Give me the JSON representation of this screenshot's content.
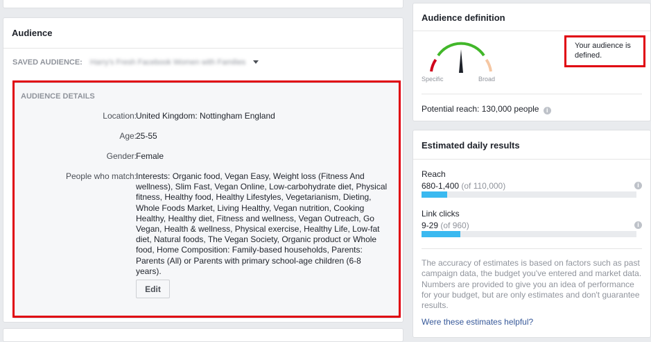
{
  "audience_card": {
    "title": "Audience",
    "saved_label": "SAVED AUDIENCE:",
    "saved_value": "Harry's Fresh Facebook Women with Families",
    "details": {
      "heading": "AUDIENCE DETAILS",
      "location_label": "Location:",
      "location_value": "United Kingdom: Nottingham England",
      "age_label": "Age:",
      "age_value": "25-55",
      "gender_label": "Gender:",
      "gender_value": "Female",
      "match_label": "People who match:",
      "match_value": "Interests: Organic food, Vegan Easy, Weight loss (Fitness And wellness), Slim Fast, Vegan Online, Low-carbohydrate diet, Physical fitness, Healthy food, Healthy Lifestyles, Vegetarianism, Dieting, Whole Foods Market, Living Healthy, Vegan nutrition, Cooking Healthy, Healthy diet, Fitness and wellness, Vegan Outreach, Go Vegan, Health & wellness, Physical exercise, Healthy Life, Low-fat diet, Natural foods, The Vegan Society, Organic product or Whole food, Home Composition: Family-based households, Parents: Parents (All) or Parents with primary school-age children (6-8 years).",
      "edit_label": "Edit"
    }
  },
  "definition_card": {
    "title": "Audience definition",
    "gauge_left": "Specific",
    "gauge_right": "Broad",
    "status_text": "Your audience is defined.",
    "reach_label": "Potential reach: 130,000 people",
    "gauge_colors": {
      "left": "#d0021b",
      "middle": "#42b72a",
      "right": "#f5c7a3",
      "needle": "#1d2129"
    }
  },
  "estimates_card": {
    "title": "Estimated daily results",
    "reach": {
      "label": "Reach",
      "range": "680-1,400",
      "total": "(of 110,000)",
      "fill_fraction": 0.12
    },
    "clicks": {
      "label": "Link clicks",
      "range": "9-29",
      "total": "(of 960)",
      "fill_fraction": 0.18
    },
    "disclaimer": "The accuracy of estimates is based on factors such as past campaign data, the budget you've entered and market data. Numbers are provided to give you an idea of performance for your budget, but are only estimates and don't guarantee results.",
    "helpful_link": "Were these estimates helpful?"
  },
  "icons": {
    "info": "info-icon",
    "dropdown": "caret-down-icon"
  },
  "colors": {
    "highlight": "#e0000f",
    "bar_fill": "#3ab9f0",
    "link": "#365899"
  }
}
